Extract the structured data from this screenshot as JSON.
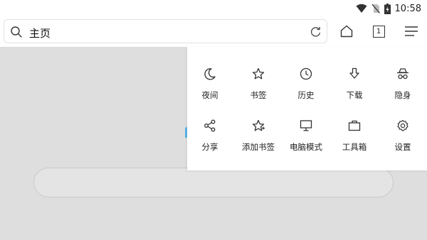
{
  "status": {
    "time": "10:58"
  },
  "search": {
    "title": "主页"
  },
  "tabs": {
    "count": "1"
  },
  "menu": {
    "items": [
      {
        "label": "夜间",
        "icon": "moon-icon"
      },
      {
        "label": "书签",
        "icon": "star-icon"
      },
      {
        "label": "历史",
        "icon": "clock-icon"
      },
      {
        "label": "下载",
        "icon": "download-icon"
      },
      {
        "label": "隐身",
        "icon": "incognito-icon"
      },
      {
        "label": "分享",
        "icon": "share-icon"
      },
      {
        "label": "添加书签",
        "icon": "star-add-icon"
      },
      {
        "label": "电脑模式",
        "icon": "monitor-icon"
      },
      {
        "label": "工具箱",
        "icon": "toolbox-icon"
      },
      {
        "label": "设置",
        "icon": "gear-icon"
      }
    ]
  }
}
